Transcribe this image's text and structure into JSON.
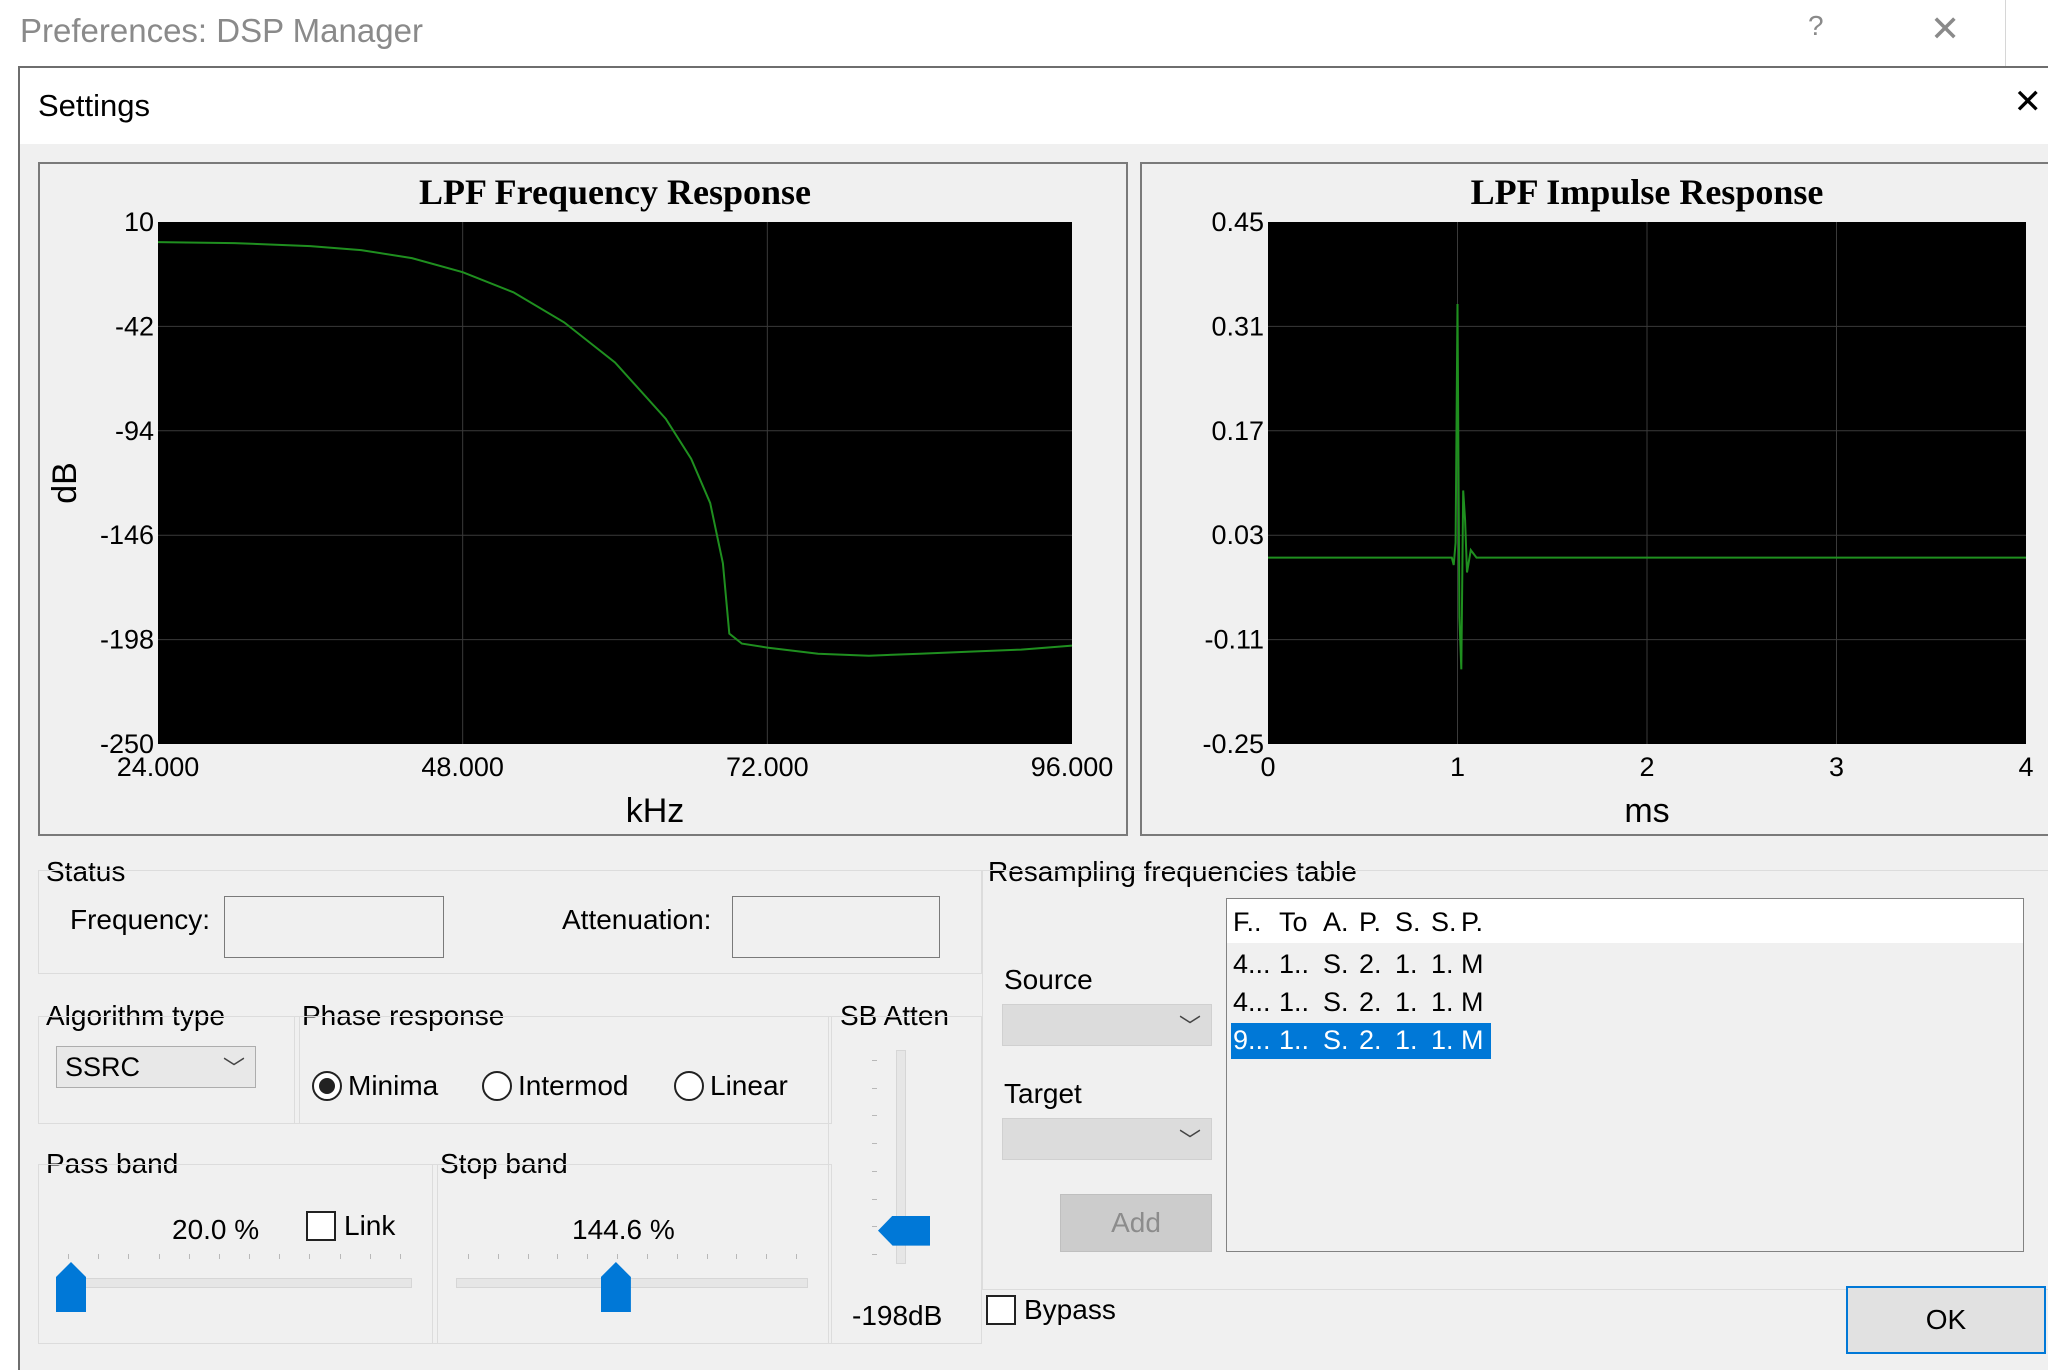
{
  "window": {
    "title": "Preferences: DSP Manager",
    "help": "?",
    "close": "✕"
  },
  "dialog": {
    "title": "Settings",
    "close": "✕"
  },
  "freq_chart": {
    "title": "LPF Frequency Response",
    "xlabel": "kHz",
    "ylabel": "dB",
    "x_ticks": [
      "24.000",
      "48.000",
      "72.000",
      "96.000"
    ],
    "y_ticks": [
      "10",
      "-42",
      "-94",
      "-146",
      "-198",
      "-250"
    ]
  },
  "impulse_chart": {
    "title": "LPF Impulse Response",
    "xlabel": "ms",
    "x_ticks": [
      "0",
      "1",
      "2",
      "3",
      "4"
    ],
    "y_ticks": [
      "0.45",
      "0.31",
      "0.17",
      "0.03",
      "-0.11",
      "-0.25"
    ]
  },
  "chart_data": [
    {
      "type": "line",
      "title": "LPF Frequency Response",
      "xlabel": "kHz",
      "ylabel": "dB",
      "xlim": [
        24,
        96
      ],
      "ylim": [
        -250,
        10
      ],
      "series": [
        {
          "color": "#1f8f1f",
          "x": [
            24,
            30,
            36,
            40,
            44,
            48,
            52,
            56,
            60,
            64,
            66,
            67.5,
            68.5,
            69,
            70,
            72,
            76,
            80,
            84,
            88,
            92,
            96
          ],
          "y": [
            0,
            -0.5,
            -2,
            -4,
            -8,
            -15,
            -25,
            -40,
            -60,
            -88,
            -108,
            -130,
            -160,
            -195,
            -200,
            -202,
            -205,
            -206,
            -205,
            -204,
            -203,
            -201
          ]
        }
      ]
    },
    {
      "type": "line",
      "title": "LPF Impulse Response",
      "xlabel": "ms",
      "xlim": [
        0,
        4
      ],
      "ylim": [
        -0.25,
        0.45
      ],
      "series": [
        {
          "color": "#1f8f1f",
          "x": [
            0,
            0.95,
            0.97,
            0.98,
            0.99,
            1.0,
            1.01,
            1.02,
            1.03,
            1.04,
            1.05,
            1.07,
            1.1,
            4
          ],
          "y": [
            0.0,
            0.0,
            0.0,
            -0.01,
            0.02,
            0.34,
            -0.08,
            -0.15,
            0.09,
            0.05,
            -0.02,
            0.01,
            0.0,
            0.0
          ]
        }
      ]
    }
  ],
  "status": {
    "label": "Status",
    "frequency_label": "Frequency:",
    "frequency_value": "",
    "attenuation_label": "Attenuation:",
    "attenuation_value": ""
  },
  "algorithm": {
    "label": "Algorithm type",
    "value": "SSRC"
  },
  "phase": {
    "label": "Phase response",
    "options": [
      {
        "label": "Minima",
        "checked": true
      },
      {
        "label": "Intermod",
        "checked": false
      },
      {
        "label": "Linear",
        "checked": false
      }
    ]
  },
  "sb_atten": {
    "label": "SB Atten",
    "value": "-198dB",
    "level": 0.9
  },
  "pass_band": {
    "label": "Pass band",
    "value": "20.0 %",
    "link_label": "Link",
    "link_checked": false,
    "level": 0.0
  },
  "stop_band": {
    "label": "Stop band",
    "value": "144.6 %",
    "level": 0.45
  },
  "resampling": {
    "label": "Resampling frequencies table",
    "source_label": "Source",
    "target_label": "Target",
    "add_label": "Add",
    "columns": [
      "F..",
      "To",
      "A.",
      "P.",
      "S.",
      "S.",
      "P."
    ],
    "rows": [
      [
        "4...",
        "1..",
        "S.",
        "2.",
        "1.",
        "1.",
        "M"
      ],
      [
        "4...",
        "1..",
        "S.",
        "2.",
        "1.",
        "1.",
        "M"
      ],
      [
        "9...",
        "1..",
        "S.",
        "2.",
        "1.",
        "1.",
        "M"
      ]
    ],
    "selected_row": 2
  },
  "bypass": {
    "label": "Bypass",
    "checked": false
  },
  "ok_label": "OK",
  "colors": {
    "accent": "#0078d7",
    "plot_bg": "#000000",
    "plot_line": "#1f8f1f",
    "grid": "#3a3a3a"
  }
}
